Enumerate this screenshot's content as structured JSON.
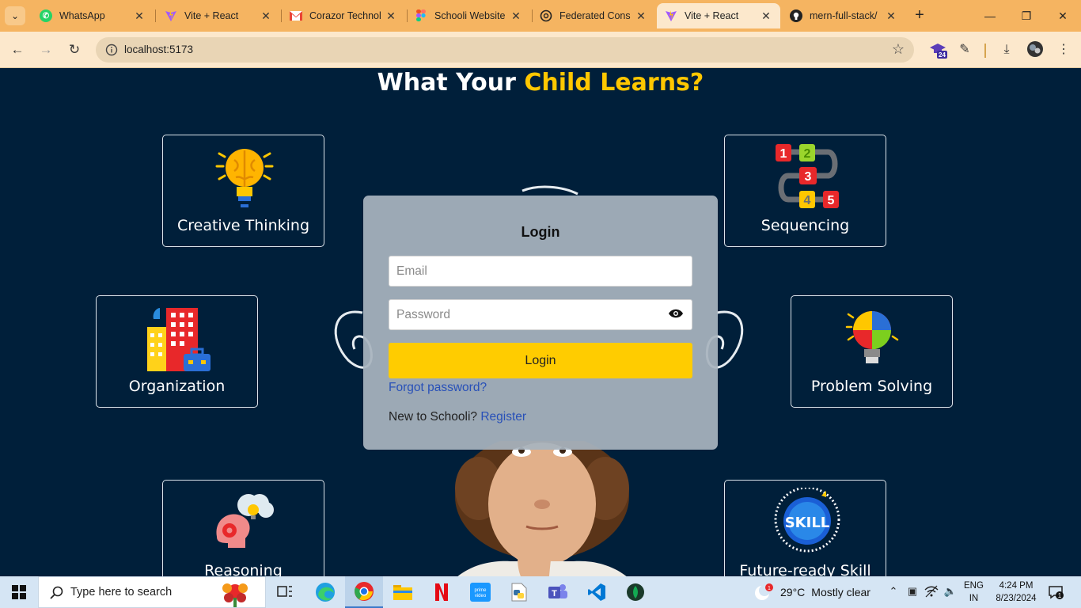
{
  "browser": {
    "tabs": [
      {
        "title": "WhatsApp",
        "icon": "whatsapp-icon",
        "color": "#25d366"
      },
      {
        "title": "Vite + React",
        "icon": "vite-icon",
        "color": "#a259ff"
      },
      {
        "title": "Corazor Technol",
        "icon": "gmail-icon",
        "color": "#ea4335"
      },
      {
        "title": "Schooli Website",
        "icon": "figma-icon",
        "color": "#f24e1e"
      },
      {
        "title": "Federated Cons",
        "icon": "openai-icon",
        "color": "#222222"
      },
      {
        "title": "Vite + React",
        "icon": "vite-icon",
        "color": "#a259ff"
      },
      {
        "title": "mern-full-stack/",
        "icon": "github-icon",
        "color": "#222222"
      }
    ],
    "active_tab_index": 5,
    "url": "localhost:5173",
    "extension_badge": "24"
  },
  "page": {
    "heading_part1": "What Your ",
    "heading_part2": "Child Learns?",
    "skills": [
      {
        "label": "Creative Thinking",
        "icon": "lightbulb-brain-icon"
      },
      {
        "label": "Sequencing",
        "icon": "numbered-path-icon"
      },
      {
        "label": "Organization",
        "icon": "buildings-icon"
      },
      {
        "label": "Problem Solving",
        "icon": "puzzle-bulb-icon"
      },
      {
        "label": "Reasoning",
        "icon": "head-gear-icon"
      },
      {
        "label": "Future-ready Skill",
        "icon": "skill-globe-icon"
      }
    ],
    "colors": {
      "accent": "#ffc700",
      "background": "#001f3a",
      "button": "#ffcc00",
      "link": "#2850b8"
    }
  },
  "login": {
    "title": "Login",
    "email_placeholder": "Email",
    "password_placeholder": "Password",
    "submit_label": "Login",
    "forgot_label": "Forgot password?",
    "register_prompt": "New to Schooli? ",
    "register_label": "Register"
  },
  "taskbar": {
    "search_placeholder": "Type here to search",
    "weather_temp": "29°C",
    "weather_desc": "Mostly clear",
    "weather_badge": "1",
    "lang_line1": "ENG",
    "lang_line2": "IN",
    "time": "4:24 PM",
    "date": "8/23/2024",
    "notification_count": "1"
  }
}
